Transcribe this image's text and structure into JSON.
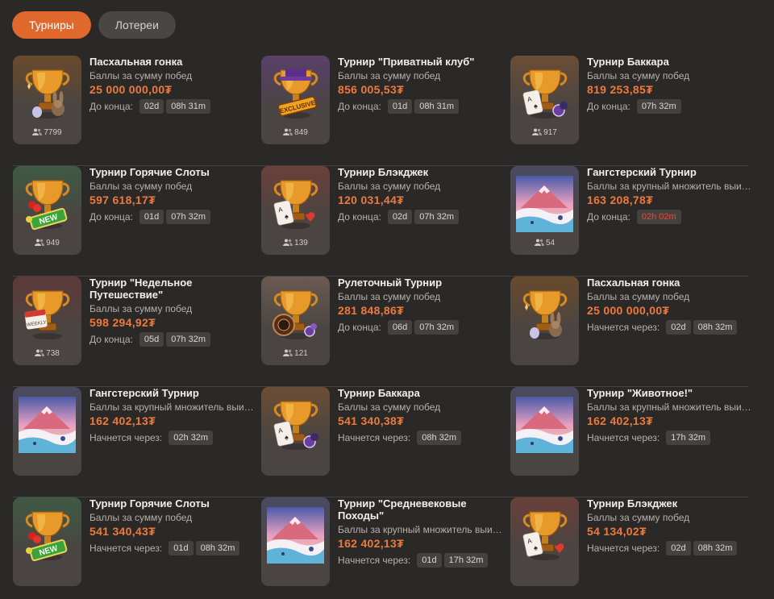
{
  "tabs": [
    {
      "label": "Турниры",
      "active": true
    },
    {
      "label": "Лотереи",
      "active": false
    }
  ],
  "colors": {
    "accent": "#e0682c",
    "prize": "#ec7a3c",
    "background": "#2b2928",
    "danger": "#e2473d"
  },
  "rows": [
    [
      {
        "title": "Пасхальная гонка",
        "subtitle": "Баллы за сумму побед",
        "prize": "25 000 000,00₮",
        "timer_label": "До конца:",
        "timer": [
          "02d",
          "08h 31m"
        ],
        "players": "7799",
        "art": "trophy-bunny"
      },
      {
        "title": "Турнир \"Приватный клуб\"",
        "subtitle": "Баллы за сумму побед",
        "prize": "856 005,53₮",
        "timer_label": "До конца:",
        "timer": [
          "01d",
          "08h 31m"
        ],
        "players": "849",
        "art": "trophy-exclusive",
        "badge": "EXCLUSIVE"
      },
      {
        "title": "Турнир Баккара",
        "subtitle": "Баллы за сумму побед",
        "prize": "819 253,85₮",
        "timer_label": "До конца:",
        "timer": [
          "07h 32m"
        ],
        "players": "917",
        "art": "trophy-cards"
      }
    ],
    [
      {
        "title": "Турнир Горячие Слоты",
        "subtitle": "Баллы за сумму побед",
        "prize": "597 618,17₮",
        "timer_label": "До конца:",
        "timer": [
          "01d",
          "07h 32m"
        ],
        "players": "949",
        "art": "trophy-new",
        "badge": "NEW"
      },
      {
        "title": "Турнир Блэкджек",
        "subtitle": "Баллы за сумму побед",
        "prize": "120 031,44₮",
        "timer_label": "До конца:",
        "timer": [
          "02d",
          "07h 32m"
        ],
        "players": "139",
        "art": "trophy-blackjack"
      },
      {
        "title": "Гангстерский Турнир",
        "subtitle": "Баллы за крупный множитель выигрыша",
        "prize": "163 208,78₮",
        "timer_label": "До конца:",
        "timer": [
          "02h 02m"
        ],
        "timer_urgent": true,
        "players": "54",
        "art": "mountain-scene"
      }
    ],
    [
      {
        "title": "Турнир \"Недельное Путешествие\"",
        "subtitle": "Баллы за сумму побед",
        "prize": "598 294,92₮",
        "timer_label": "До конца:",
        "timer": [
          "05d",
          "07h 32m"
        ],
        "players": "738",
        "art": "trophy-calendar",
        "badge": "WEEKLY"
      },
      {
        "title": "Рулеточный Турнир",
        "subtitle": "Баллы за сумму побед",
        "prize": "281 848,86₮",
        "timer_label": "До конца:",
        "timer": [
          "06d",
          "07h 32m"
        ],
        "players": "121",
        "art": "trophy-roulette"
      },
      {
        "title": "Пасхальная гонка",
        "subtitle": "Баллы за сумму побед",
        "prize": "25 000 000,00₮",
        "timer_label": "Начнется через:",
        "timer": [
          "02d",
          "08h 32m"
        ],
        "art": "trophy-bunny"
      }
    ],
    [
      {
        "title": "Гангстерский Турнир",
        "subtitle": "Баллы за крупный множитель выигрыша",
        "prize": "162 402,13₮",
        "timer_label": "Начнется через:",
        "timer": [
          "02h 32m"
        ],
        "art": "mountain-scene"
      },
      {
        "title": "Турнир Баккара",
        "subtitle": "Баллы за сумму побед",
        "prize": "541 340,38₮",
        "timer_label": "Начнется через:",
        "timer": [
          "08h 32m"
        ],
        "art": "trophy-cards"
      },
      {
        "title": "Турнир \"Животное!\"",
        "subtitle": "Баллы за крупный множитель выигрыша",
        "prize": "162 402,13₮",
        "timer_label": "Начнется через:",
        "timer": [
          "17h 32m"
        ],
        "art": "mountain-scene"
      }
    ],
    [
      {
        "title": "Турнир Горячие Слоты",
        "subtitle": "Баллы за сумму побед",
        "prize": "541 340,43₮",
        "timer_label": "Начнется через:",
        "timer": [
          "01d",
          "08h 32m"
        ],
        "art": "trophy-new",
        "badge": "NEW"
      },
      {
        "title": "Турнир \"Средневековые Походы\"",
        "subtitle": "Баллы за крупный множитель выигрыша",
        "prize": "162 402,13₮",
        "timer_label": "Начнется через:",
        "timer": [
          "01d",
          "17h 32m"
        ],
        "art": "mountain-scene"
      },
      {
        "title": "Турнир Блэкджек",
        "subtitle": "Баллы за сумму побед",
        "prize": "54 134,02₮",
        "timer_label": "Начнется через:",
        "timer": [
          "02d",
          "08h 32m"
        ],
        "art": "trophy-blackjack"
      }
    ]
  ]
}
